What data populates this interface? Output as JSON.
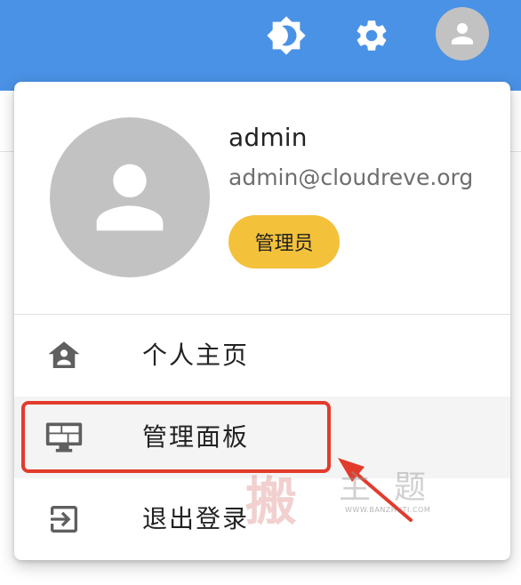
{
  "appbar": {
    "color": "#4a92e6",
    "icons": [
      "theme-toggle-icon",
      "settings-icon",
      "user-avatar-icon"
    ]
  },
  "profile": {
    "username": "admin",
    "email": "admin@cloudreve.org",
    "role": "管理员"
  },
  "menu": {
    "items": [
      {
        "icon": "home-user-icon",
        "label": "个人主页"
      },
      {
        "icon": "admin-panel-icon",
        "label": "管理面板"
      },
      {
        "icon": "logout-icon",
        "label": "退出登录"
      }
    ],
    "selected_item": "管理面板"
  },
  "annotation": {
    "highlight_color": "#e23b2c"
  },
  "watermark": {
    "seal": "搬",
    "title": "主题",
    "url": "WWW.BANZHUTI.COM"
  }
}
